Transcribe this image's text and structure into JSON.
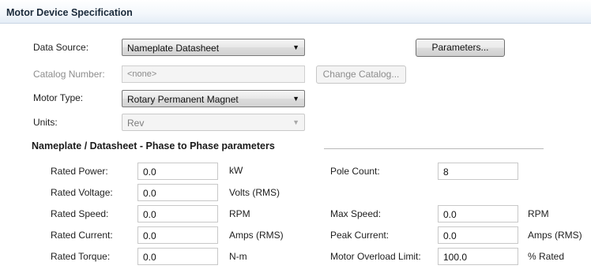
{
  "panel": {
    "title": "Motor Device Specification"
  },
  "data_source": {
    "label": "Data Source:",
    "value": "Nameplate Datasheet"
  },
  "parameters_button": {
    "label": "Parameters..."
  },
  "catalog": {
    "label": "Catalog Number:",
    "value": "<none>",
    "change_label": "Change Catalog..."
  },
  "motor_type": {
    "label": "Motor Type:",
    "value": "Rotary Permanent Magnet"
  },
  "units": {
    "label": "Units:",
    "value": "Rev"
  },
  "nameplate": {
    "title": "Nameplate / Datasheet - Phase to Phase parameters",
    "rated_power": {
      "label": "Rated Power:",
      "value": "0.0",
      "unit": "kW"
    },
    "rated_voltage": {
      "label": "Rated Voltage:",
      "value": "0.0",
      "unit": "Volts (RMS)"
    },
    "rated_speed": {
      "label": "Rated Speed:",
      "value": "0.0",
      "unit": "RPM"
    },
    "rated_current": {
      "label": "Rated Current:",
      "value": "0.0",
      "unit": "Amps (RMS)"
    },
    "rated_torque": {
      "label": "Rated Torque:",
      "value": "0.0",
      "unit": "N-m"
    },
    "pole_count": {
      "label": "Pole Count:",
      "value": "8"
    },
    "max_speed": {
      "label": "Max Speed:",
      "value": "0.0",
      "unit": "RPM"
    },
    "peak_current": {
      "label": "Peak Current:",
      "value": "0.0",
      "unit": "Amps (RMS)"
    },
    "overload_limit": {
      "label": "Motor Overload Limit:",
      "value": "100.0",
      "unit": "% Rated"
    }
  }
}
